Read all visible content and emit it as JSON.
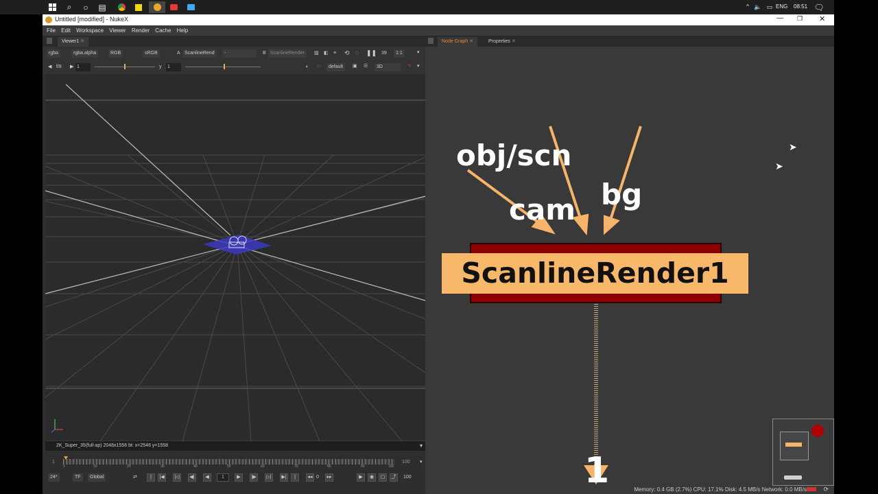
{
  "taskbar": {
    "icons": [
      "windows-logo",
      "search-icon",
      "cortana-icon",
      "task-view-icon",
      "chrome-icon",
      "sticky-notes-icon",
      "nuke-icon",
      "screen-recorder-icon",
      "messages-icon"
    ],
    "lang": "ENG",
    "time": "08:51"
  },
  "window": {
    "title": "Untitled [modified] - NukeX",
    "menu": [
      "File",
      "Edit",
      "Workspace",
      "Viewer",
      "Render",
      "Cache",
      "Help"
    ]
  },
  "viewer_panel": {
    "tab": "Viewer1",
    "row1": {
      "channels": "rgba",
      "alpha": "rgba.alpha",
      "display": "RGB",
      "lut": "sRGB",
      "a_label": "A",
      "a_input": "ScanlineRend",
      "a_mode": "-",
      "b_label": "B",
      "b_input": "ScanlineRender",
      "zoom": "1:1",
      "proxy": "39"
    },
    "row2": {
      "fstop": "f/8",
      "gain": "1",
      "y_label": "y",
      "gamma": "1",
      "look": "default",
      "mode": "3D"
    },
    "status": "2K_Super_35(full-ap) 2048x1556  bt:  x=2546 y=1558",
    "timeline": {
      "start": "1",
      "end": "100",
      "ticks": [
        "1",
        "10",
        "20",
        "30",
        "40",
        "50",
        "60",
        "70",
        "80",
        "90",
        "100"
      ],
      "fps": "24*",
      "tf": "TF",
      "range": "Global",
      "frame": "1",
      "step": "0",
      "inc": "10",
      "end_frame": "100"
    }
  },
  "nodegraph_panel": {
    "tabs": [
      "Node Graph",
      "Properties"
    ],
    "inputs": [
      "obj/scn",
      "cam",
      "bg"
    ],
    "node": {
      "name": "ScanlineRender1",
      "output": "1"
    },
    "status": "Memory: 0.4 GB (2.7%) CPU: 17.1% Disk: 4.5 MB/s Network: 0.0 MB/s"
  },
  "colors": {
    "node_fill": "#f7b86a",
    "node_border": "#8d0000",
    "arrow": "#f5b467",
    "active_tab": "#e88a3c"
  }
}
